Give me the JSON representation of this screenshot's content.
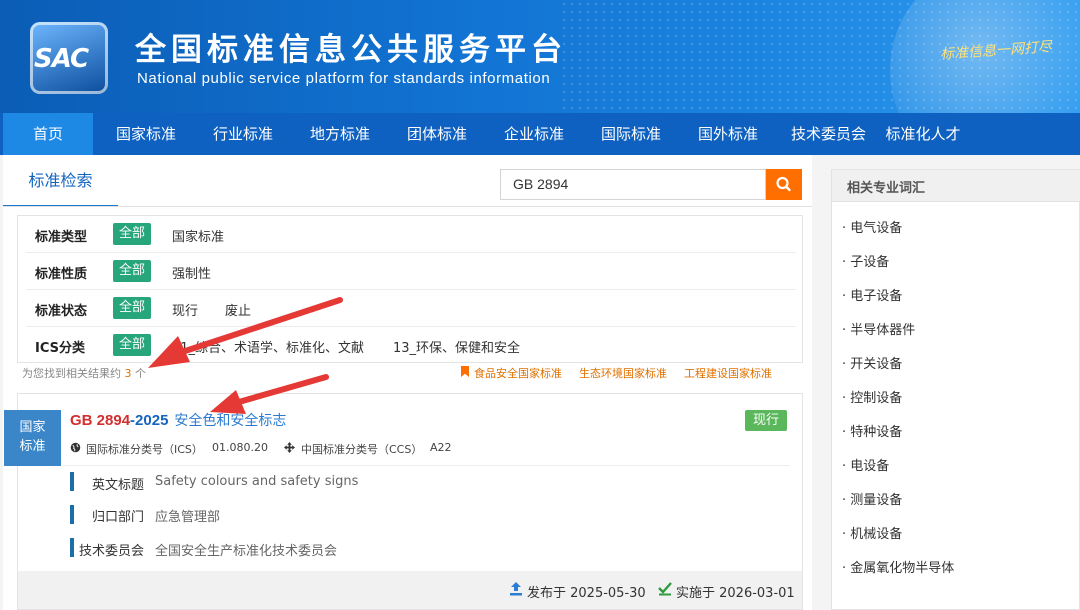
{
  "header": {
    "logo_text": "SAC",
    "title": "全国标准信息公共服务平台",
    "subtitle": "National public service platform  for standards information",
    "slogan": "标准信息一网打尽"
  },
  "nav": {
    "items": [
      {
        "label": "首页",
        "active": true
      },
      {
        "label": "国家标准"
      },
      {
        "label": "行业标准"
      },
      {
        "label": "地方标准"
      },
      {
        "label": "团体标准"
      },
      {
        "label": "企业标准"
      },
      {
        "label": "国际标准"
      },
      {
        "label": "国外标准"
      },
      {
        "label": "技术委员会"
      },
      {
        "label": "标准化人才"
      }
    ]
  },
  "search": {
    "tab_label": "标准检索",
    "query": "GB 2894"
  },
  "filters": [
    {
      "label": "标准类型",
      "all": "全部",
      "options": [
        "国家标准"
      ]
    },
    {
      "label": "标准性质",
      "all": "全部",
      "options": [
        "强制性"
      ]
    },
    {
      "label": "标准状态",
      "all": "全部",
      "options": [
        "现行",
        "废止"
      ]
    },
    {
      "label": "ICS分类",
      "all": "全部",
      "options": [
        "01_综合、术语学、标准化、文献",
        "13_环保、保健和安全"
      ]
    }
  ],
  "results_summary": {
    "prefix": "为您找到相关结果约",
    "count": "3",
    "suffix": "个"
  },
  "quick_links": [
    "食品安全国家标准",
    "生态环境国家标准",
    "工程建设国家标准"
  ],
  "result": {
    "type_badge": "国家标准",
    "code": "GB 2894",
    "year": "-2025",
    "name": "安全色和安全标志",
    "status": "现行",
    "ics_label": "国际标准分类号（ICS）",
    "ics_value": "01.080.20",
    "ccs_label": "中国标准分类号（CCS）",
    "ccs_value": "A22",
    "fields": [
      {
        "label": "英文标题",
        "value": "Safety colours and safety signs"
      },
      {
        "label": "归口部门",
        "value": "应急管理部"
      },
      {
        "label": "技术委员会",
        "value": "全国安全生产标准化技术委员会"
      }
    ],
    "published": "发布于 2025-05-30",
    "effective": "实施于 2026-03-01"
  },
  "sidebar": {
    "title": "相关专业词汇",
    "terms": [
      "· 电气设备",
      "· 子设备",
      "· 电子设备",
      "· 半导体器件",
      "· 开关设备",
      "· 控制设备",
      "· 特种设备",
      "· 电设备",
      "· 测量设备",
      "· 机械设备",
      "· 金属氧化物半导体"
    ]
  },
  "colors": {
    "nav_bg": "#0e61c0",
    "accent_orange": "#ff6f00",
    "tag_green": "#26a67a",
    "status_green": "#5bb75b",
    "annotation_red": "#e53935"
  }
}
